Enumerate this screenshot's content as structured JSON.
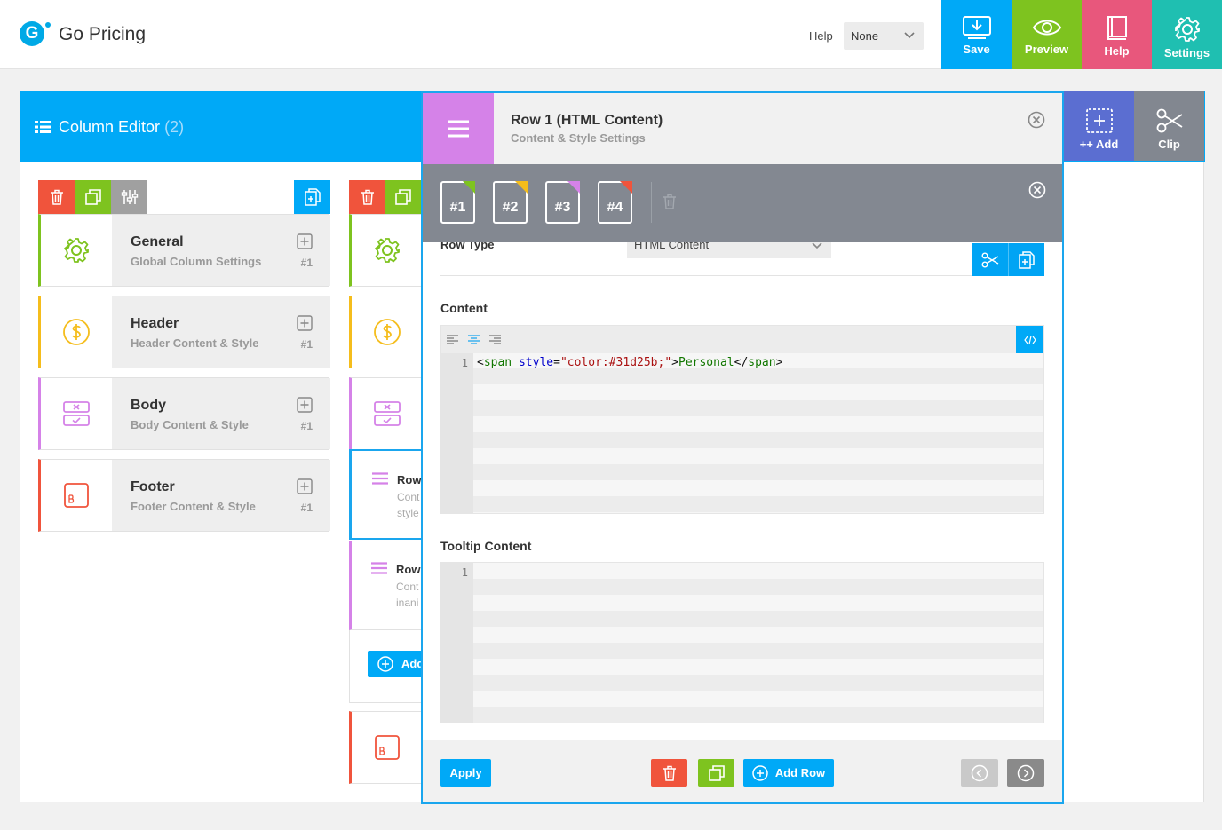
{
  "app": {
    "name": "Go Pricing",
    "logo_letter": "G"
  },
  "topbar": {
    "help_label": "Help",
    "help_select": "None",
    "buttons": [
      {
        "label": "Save",
        "icon": "save-icon",
        "color": "#00a9f7"
      },
      {
        "label": "Preview",
        "icon": "eye-icon",
        "color": "#7ec31f"
      },
      {
        "label": "Help",
        "icon": "book-icon",
        "color": "#e8577c"
      },
      {
        "label": "Settings",
        "icon": "gear-icon",
        "color": "#1fbfb1"
      }
    ]
  },
  "editor": {
    "title": "Column Editor",
    "count": "(2)",
    "side_buttons": [
      {
        "label": "++ Add",
        "icon": "add-icon",
        "color": "#5b6ed1"
      },
      {
        "label": "Clip",
        "icon": "scissors-icon",
        "color": "#828790"
      }
    ],
    "column1": {
      "cards": [
        {
          "title": "General",
          "subtitle": "Global Column Settings",
          "num": "#1",
          "icon": "gear-icon",
          "color": "#7ec31f"
        },
        {
          "title": "Header",
          "subtitle": "Header Content & Style",
          "num": "#1",
          "icon": "dollar-icon",
          "color": "#f5bd1c"
        },
        {
          "title": "Body",
          "subtitle": "Body Content & Style",
          "num": "#1",
          "icon": "body-rows-icon",
          "color": "#d582e8"
        },
        {
          "title": "Footer",
          "subtitle": "Footer Content & Style",
          "num": "#1",
          "icon": "footer-button-icon",
          "color": "#f0543c"
        }
      ]
    },
    "column2": {
      "rows": [
        {
          "title": "Row",
          "line1": "Cont",
          "line2": "style"
        },
        {
          "title": "Row",
          "line1": "Cont",
          "line2": "inani"
        }
      ],
      "add_label": "Add"
    },
    "colors": {
      "delete": "#f0543c",
      "clone": "#7ec31f",
      "sliders": "#a0a0a0",
      "copy": "#00a9f7"
    }
  },
  "modal": {
    "title": "Row 1 (HTML Content)",
    "subtitle": "Content & Style Settings",
    "tabs": [
      {
        "label": "#1",
        "corner": "#7ec31f"
      },
      {
        "label": "#2",
        "corner": "#f5bd1c"
      },
      {
        "label": "#3",
        "corner": "#d582e8"
      },
      {
        "label": "#4",
        "corner": "#f0543c"
      }
    ],
    "row_type_label": "Row Type",
    "row_type_value": "HTML Content",
    "content_label": "Content",
    "content_line_number": "1",
    "content_code": {
      "lt": "<",
      "tag": "span",
      "attr": " style",
      "eq": "=",
      "str": "\"color:#31d25b;\"",
      "gt": ">",
      "text": "Personal",
      "close_lt": "</",
      "close_tag": "span",
      "close_gt": ">"
    },
    "tooltip_label": "Tooltip Content",
    "tooltip_line_number": "1",
    "footer": {
      "apply": "Apply",
      "add_row": "Add Row"
    }
  }
}
